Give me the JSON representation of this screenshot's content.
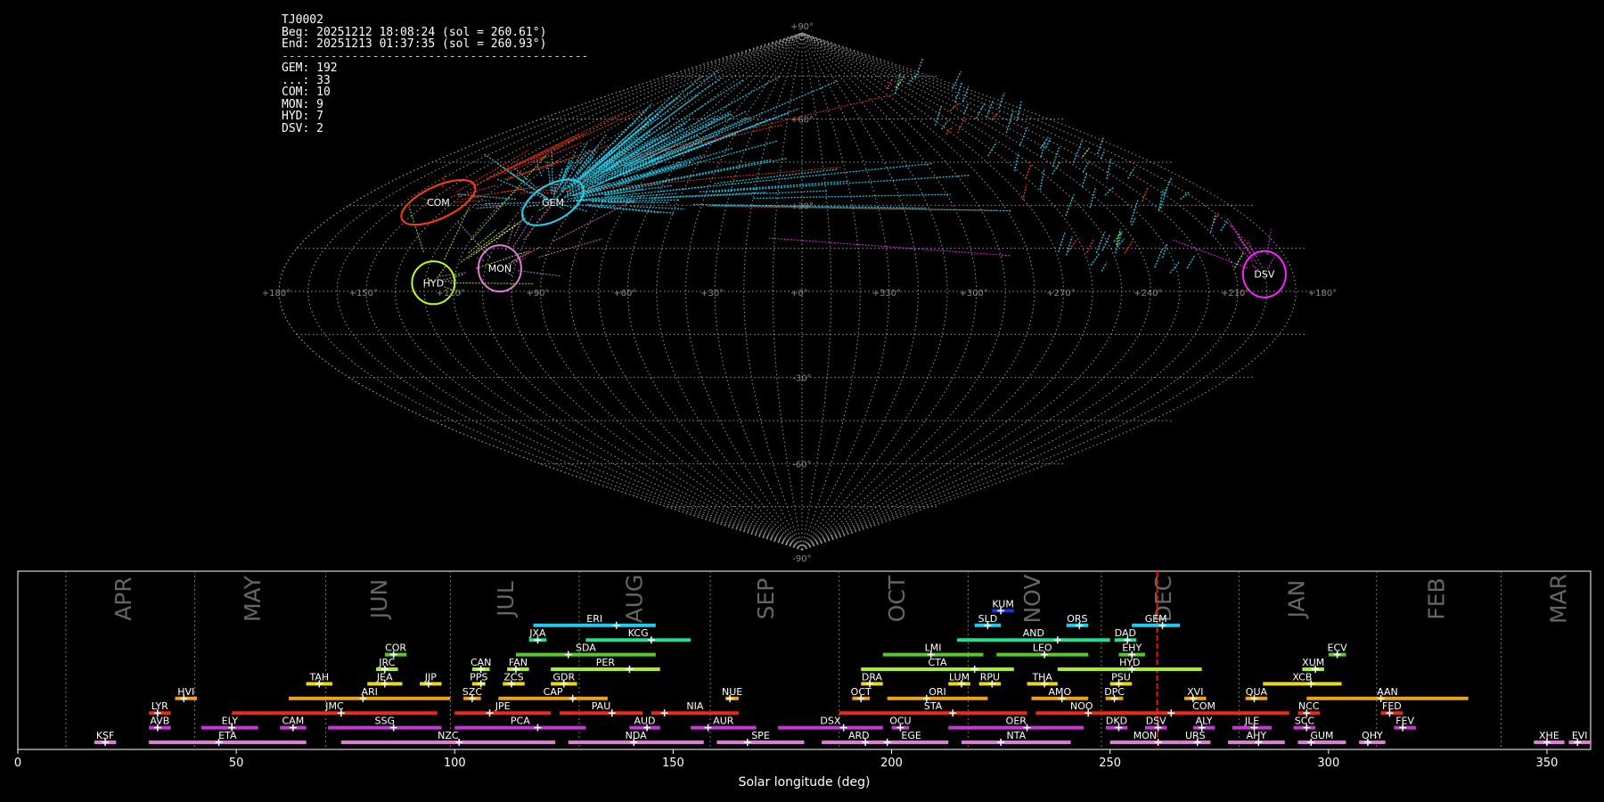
{
  "info": {
    "station": "TJ0002",
    "beg": "Beg: 20251212 18:08:24 (sol = 260.61°)",
    "end": "End: 20251213 01:37:35 (sol = 260.93°)",
    "sep": "--------------------------------------------",
    "counts": [
      "GEM: 192",
      "...: 33",
      "COM: 10",
      "MON: 9",
      "HYD: 7",
      "DSV: 2"
    ]
  },
  "sky_labels": {
    "lon_ticks": [
      "+180°",
      "+150°",
      "+120°",
      "+90°",
      "+60°",
      "+30°",
      "+0°",
      "+330°",
      "+300°",
      "+270°",
      "+240°",
      "+210°",
      "+180°"
    ],
    "lat_ticks": [
      "+90°",
      "+60°",
      "+30°",
      "-30°",
      "-60°",
      "-90°"
    ],
    "radiants": [
      {
        "name": "COM",
        "lon": 146,
        "lat": 31,
        "color": "#ff3a1a"
      },
      {
        "name": "GEM",
        "lon": 100,
        "lat": 31,
        "color": "#22d0ee"
      },
      {
        "name": "MON",
        "lon": 105,
        "lat": 8,
        "color": "#e07ad8"
      },
      {
        "name": "HYD",
        "lon": 127,
        "lat": 3,
        "color": "#bfff1a"
      },
      {
        "name": "DSV",
        "lon": 200,
        "lat": 6,
        "color": "#ff22ff"
      }
    ]
  },
  "chart_data": {
    "type": "timeline",
    "xlabel": "Solar longitude (deg)",
    "xlim": [
      0,
      360
    ],
    "xticks": [
      0,
      50,
      100,
      150,
      200,
      250,
      300,
      350
    ],
    "current_sol": 260.8,
    "months": [
      {
        "name": "APR",
        "x": 24.5
      },
      {
        "name": "MAY",
        "x": 54
      },
      {
        "name": "JUN",
        "x": 83
      },
      {
        "name": "JUL",
        "x": 112
      },
      {
        "name": "AUG",
        "x": 141.5
      },
      {
        "name": "SEP",
        "x": 171.5
      },
      {
        "name": "OCT",
        "x": 201.5
      },
      {
        "name": "NOV",
        "x": 232.5
      },
      {
        "name": "DEC",
        "x": 262.5
      },
      {
        "name": "JAN",
        "x": 293
      },
      {
        "name": "FEB",
        "x": 325
      },
      {
        "name": "MAR",
        "x": 353
      }
    ],
    "month_boundaries": [
      11,
      40.5,
      70.5,
      99,
      128.5,
      158.5,
      188,
      217.5,
      248,
      279.5,
      311,
      339.5
    ],
    "showers": [
      {
        "code": "KSF",
        "start": 17.5,
        "end": 22.5,
        "peak": 20,
        "row": 0,
        "color": "#e07ad8"
      },
      {
        "code": "ETA",
        "start": 30,
        "end": 66,
        "peak": 46,
        "row": 0,
        "color": "#e07ad8"
      },
      {
        "code": "NZC",
        "start": 74,
        "end": 123,
        "peak": 101,
        "row": 0,
        "color": "#e07ad8"
      },
      {
        "code": "NDA",
        "start": 126,
        "end": 157,
        "peak": 141,
        "row": 0,
        "color": "#e07ad8"
      },
      {
        "code": "SPE",
        "start": 160,
        "end": 180,
        "peak": 167,
        "row": 0,
        "color": "#e07ad8"
      },
      {
        "code": "ARD",
        "start": 184,
        "end": 201,
        "peak": 194,
        "row": 0,
        "color": "#e07ad8"
      },
      {
        "code": "EGE",
        "start": 196,
        "end": 213,
        "peak": 199,
        "row": 0,
        "color": "#e07ad8"
      },
      {
        "code": "NTA",
        "start": 216,
        "end": 241,
        "peak": 225,
        "row": 0,
        "color": "#e07ad8"
      },
      {
        "code": "MON",
        "start": 250,
        "end": 266,
        "peak": 261,
        "row": 0,
        "color": "#e07ad8"
      },
      {
        "code": "URS",
        "start": 266,
        "end": 273,
        "peak": 270,
        "row": 0,
        "color": "#e07ad8"
      },
      {
        "code": "AHY",
        "start": 277,
        "end": 290,
        "peak": 284,
        "row": 0,
        "color": "#e07ad8"
      },
      {
        "code": "GUM",
        "start": 293,
        "end": 304,
        "peak": 296,
        "row": 0,
        "color": "#e07ad8"
      },
      {
        "code": "OHY",
        "start": 307,
        "end": 313,
        "peak": 309,
        "row": 0,
        "color": "#e07ad8"
      },
      {
        "code": "XHE",
        "start": 347,
        "end": 354,
        "peak": 350,
        "row": 0,
        "color": "#e07ad8"
      },
      {
        "code": "EVI",
        "start": 355,
        "end": 360,
        "peak": 357,
        "row": 0,
        "color": "#e07ad8"
      },
      {
        "code": "AVB",
        "start": 30,
        "end": 35,
        "peak": 32,
        "row": 1,
        "color": "#cc33dd"
      },
      {
        "code": "ELY",
        "start": 42,
        "end": 55,
        "peak": 49,
        "row": 1,
        "color": "#cc33dd"
      },
      {
        "code": "CAM",
        "start": 60,
        "end": 66,
        "peak": 63,
        "row": 1,
        "color": "#cc33dd"
      },
      {
        "code": "SSG",
        "start": 71,
        "end": 97,
        "peak": 86,
        "row": 1,
        "color": "#cc33dd"
      },
      {
        "code": "PCA",
        "start": 100,
        "end": 130,
        "peak": 119,
        "row": 1,
        "color": "#cc33dd"
      },
      {
        "code": "AUD",
        "start": 140,
        "end": 147,
        "peak": 144,
        "row": 1,
        "color": "#cc33dd"
      },
      {
        "code": "AUR",
        "start": 154,
        "end": 169,
        "peak": 158,
        "row": 1,
        "color": "#cc33dd"
      },
      {
        "code": "DSX",
        "start": 174,
        "end": 198,
        "peak": 189,
        "row": 1,
        "color": "#cc33dd"
      },
      {
        "code": "OCU",
        "start": 200,
        "end": 204,
        "peak": 202,
        "row": 1,
        "color": "#cc33dd"
      },
      {
        "code": "OER",
        "start": 213,
        "end": 244,
        "peak": 231,
        "row": 1,
        "color": "#cc33dd"
      },
      {
        "code": "DKD",
        "start": 249,
        "end": 254,
        "peak": 252,
        "row": 1,
        "color": "#cc33dd"
      },
      {
        "code": "DSV",
        "start": 258,
        "end": 263,
        "peak": 261,
        "row": 1,
        "color": "#cc33dd"
      },
      {
        "code": "ALY",
        "start": 269,
        "end": 274,
        "peak": 271,
        "row": 1,
        "color": "#cc33dd"
      },
      {
        "code": "JLE",
        "start": 278,
        "end": 287,
        "peak": 283,
        "row": 1,
        "color": "#cc33dd"
      },
      {
        "code": "SCC",
        "start": 292,
        "end": 297,
        "peak": 295,
        "row": 1,
        "color": "#cc33dd"
      },
      {
        "code": "FEV",
        "start": 315,
        "end": 320,
        "peak": 317,
        "row": 1,
        "color": "#cc33dd"
      },
      {
        "code": "LYR",
        "start": 30,
        "end": 35,
        "peak": 32,
        "row": 2,
        "color": "#ee2a10"
      },
      {
        "code": "JMC",
        "start": 49,
        "end": 96,
        "peak": 74,
        "row": 2,
        "color": "#ee2a10"
      },
      {
        "code": "JPE",
        "start": 100,
        "end": 122,
        "peak": 108,
        "row": 2,
        "color": "#ee2a10"
      },
      {
        "code": "PAU",
        "start": 124,
        "end": 143,
        "peak": 136,
        "row": 2,
        "color": "#ee2a10"
      },
      {
        "code": "NIA",
        "start": 145,
        "end": 165,
        "peak": 148,
        "row": 2,
        "color": "#ee2a10"
      },
      {
        "code": "STA",
        "start": 188,
        "end": 231,
        "peak": 214,
        "row": 2,
        "color": "#ee2a10"
      },
      {
        "code": "NOO",
        "start": 233,
        "end": 254,
        "peak": 245,
        "row": 2,
        "color": "#ee2a10"
      },
      {
        "code": "COM",
        "start": 252,
        "end": 291,
        "peak": 264,
        "row": 2,
        "color": "#ee2a10"
      },
      {
        "code": "NCC",
        "start": 293,
        "end": 298,
        "peak": 295,
        "row": 2,
        "color": "#ee2a10"
      },
      {
        "code": "FED",
        "start": 312,
        "end": 317,
        "peak": 314,
        "row": 2,
        "color": "#ee2a10"
      },
      {
        "code": "HVI",
        "start": 36,
        "end": 41,
        "peak": 38,
        "row": 3,
        "color": "#f0a020"
      },
      {
        "code": "ARI",
        "start": 62,
        "end": 99,
        "peak": 79,
        "row": 3,
        "color": "#f0a020"
      },
      {
        "code": "SZC",
        "start": 102,
        "end": 106,
        "peak": 104,
        "row": 3,
        "color": "#f0a020"
      },
      {
        "code": "CAP",
        "start": 110,
        "end": 135,
        "peak": 127,
        "row": 3,
        "color": "#f0a020"
      },
      {
        "code": "NUE",
        "start": 162,
        "end": 165,
        "peak": 163,
        "row": 3,
        "color": "#f0a020"
      },
      {
        "code": "OCT",
        "start": 191,
        "end": 195,
        "peak": 193,
        "row": 3,
        "color": "#f0a020"
      },
      {
        "code": "ORI",
        "start": 199,
        "end": 222,
        "peak": 208,
        "row": 3,
        "color": "#f0a020"
      },
      {
        "code": "AMO",
        "start": 232,
        "end": 245,
        "peak": 239,
        "row": 3,
        "color": "#f0a020"
      },
      {
        "code": "DPC",
        "start": 249,
        "end": 253,
        "peak": 251,
        "row": 3,
        "color": "#f0a020"
      },
      {
        "code": "XVI",
        "start": 267,
        "end": 272,
        "peak": 269,
        "row": 3,
        "color": "#f0a020"
      },
      {
        "code": "QUA",
        "start": 281,
        "end": 286,
        "peak": 283,
        "row": 3,
        "color": "#f0a020"
      },
      {
        "code": "AAN",
        "start": 295,
        "end": 332,
        "peak": 312,
        "row": 3,
        "color": "#f0a020"
      },
      {
        "code": "TAH",
        "start": 66,
        "end": 72,
        "peak": 69,
        "row": 4,
        "color": "#e8d818"
      },
      {
        "code": "JEA",
        "start": 80,
        "end": 88,
        "peak": 84,
        "row": 4,
        "color": "#e8d818"
      },
      {
        "code": "JIP",
        "start": 92,
        "end": 97,
        "peak": 94,
        "row": 4,
        "color": "#e8d818"
      },
      {
        "code": "PPS",
        "start": 104,
        "end": 107,
        "peak": 106,
        "row": 4,
        "color": "#e8d818"
      },
      {
        "code": "ZCS",
        "start": 111,
        "end": 116,
        "peak": 113,
        "row": 4,
        "color": "#e8d818"
      },
      {
        "code": "GDR",
        "start": 122,
        "end": 128,
        "peak": 125,
        "row": 4,
        "color": "#e8d818"
      },
      {
        "code": "DRA",
        "start": 193,
        "end": 198,
        "peak": 195,
        "row": 4,
        "color": "#e8d818"
      },
      {
        "code": "LUM",
        "start": 213,
        "end": 218,
        "peak": 216,
        "row": 4,
        "color": "#e8d818"
      },
      {
        "code": "RPU",
        "start": 220,
        "end": 225,
        "peak": 223,
        "row": 4,
        "color": "#e8d818"
      },
      {
        "code": "THA",
        "start": 231,
        "end": 238,
        "peak": 235,
        "row": 4,
        "color": "#e8d818"
      },
      {
        "code": "PSU",
        "start": 250,
        "end": 255,
        "peak": 252,
        "row": 4,
        "color": "#e8d818"
      },
      {
        "code": "XCB",
        "start": 285,
        "end": 303,
        "peak": 296,
        "row": 4,
        "color": "#e8d818"
      },
      {
        "code": "JRC",
        "start": 82,
        "end": 87,
        "peak": 84,
        "row": 5,
        "color": "#aaee22"
      },
      {
        "code": "CAN",
        "start": 104,
        "end": 108,
        "peak": 106,
        "row": 5,
        "color": "#aaee22"
      },
      {
        "code": "FAN",
        "start": 112,
        "end": 117,
        "peak": 114,
        "row": 5,
        "color": "#aaee22"
      },
      {
        "code": "PER",
        "start": 122,
        "end": 147,
        "peak": 140,
        "row": 5,
        "color": "#aaee22"
      },
      {
        "code": "CTA",
        "start": 193,
        "end": 228,
        "peak": 219,
        "row": 5,
        "color": "#aaee22"
      },
      {
        "code": "HYD",
        "start": 238,
        "end": 271,
        "peak": 255,
        "row": 5,
        "color": "#aaee22"
      },
      {
        "code": "XUM",
        "start": 294,
        "end": 299,
        "peak": 297,
        "row": 5,
        "color": "#aaee22"
      },
      {
        "code": "COR",
        "start": 84,
        "end": 89,
        "peak": 86,
        "row": 6,
        "color": "#55cc22"
      },
      {
        "code": "SDA",
        "start": 114,
        "end": 146,
        "peak": 126,
        "row": 6,
        "color": "#55cc22"
      },
      {
        "code": "LMI",
        "start": 198,
        "end": 221,
        "peak": 209,
        "row": 6,
        "color": "#55cc22"
      },
      {
        "code": "LEO",
        "start": 224,
        "end": 245,
        "peak": 235,
        "row": 6,
        "color": "#55cc22"
      },
      {
        "code": "EHY",
        "start": 252,
        "end": 258,
        "peak": 255,
        "row": 6,
        "color": "#55cc22"
      },
      {
        "code": "ECV",
        "start": 300,
        "end": 304,
        "peak": 302,
        "row": 6,
        "color": "#55cc22"
      },
      {
        "code": "JXA",
        "start": 117,
        "end": 121,
        "peak": 119,
        "row": 7,
        "color": "#20e090"
      },
      {
        "code": "KCG",
        "start": 130,
        "end": 154,
        "peak": 145,
        "row": 7,
        "color": "#20e090"
      },
      {
        "code": "AND",
        "start": 215,
        "end": 250,
        "peak": 238,
        "row": 7,
        "color": "#20e090"
      },
      {
        "code": "DAD",
        "start": 251,
        "end": 256,
        "peak": 254,
        "row": 7,
        "color": "#20e090"
      },
      {
        "code": "ERI",
        "start": 118,
        "end": 146,
        "peak": 137,
        "row": 8,
        "color": "#22ccee"
      },
      {
        "code": "SLD",
        "start": 219,
        "end": 225,
        "peak": 222,
        "row": 8,
        "color": "#22ccee"
      },
      {
        "code": "ORS",
        "start": 240,
        "end": 245,
        "peak": 243,
        "row": 8,
        "color": "#22ccee"
      },
      {
        "code": "GEM",
        "start": 255,
        "end": 266,
        "peak": 262,
        "row": 8,
        "color": "#22ccee"
      },
      {
        "code": "KUM",
        "start": 223,
        "end": 228,
        "peak": 225,
        "row": 9,
        "color": "#2030dd"
      }
    ]
  }
}
